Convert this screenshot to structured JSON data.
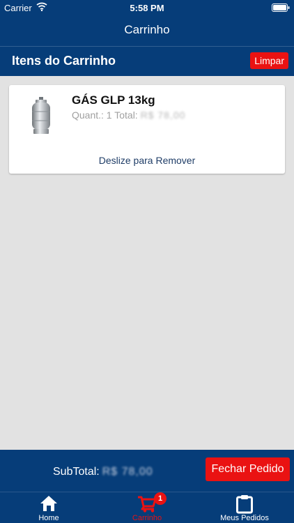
{
  "status_bar": {
    "carrier": "Carrier",
    "time": "5:58 PM"
  },
  "header": {
    "title": "Carrinho",
    "section_title": "Itens do Carrinho",
    "clear_label": "Limpar"
  },
  "cart": {
    "items": [
      {
        "name": "GÁS GLP 13kg",
        "quantity_text": "Quant.: 1 Total:",
        "price_text": "R$ 78,00",
        "icon": "gas-cylinder-icon"
      }
    ],
    "swipe_hint": "Deslize para Remover"
  },
  "footer": {
    "subtotal_label": "SubTotal:",
    "subtotal_value": "R$ 78,00",
    "checkout_label": "Fechar Pedido"
  },
  "tabs": [
    {
      "label": "Home",
      "icon": "home-icon"
    },
    {
      "label": "Carrinho",
      "icon": "cart-icon",
      "badge": "1",
      "active": true
    },
    {
      "label": "Meus Pedidos",
      "icon": "clipboard-icon"
    }
  ],
  "colors": {
    "navy": "#063d79",
    "red": "#ea1212",
    "background": "#e2e2e2",
    "card": "#ffffff",
    "muted_text": "#a0a0a0",
    "link_text": "#1f3d67"
  }
}
